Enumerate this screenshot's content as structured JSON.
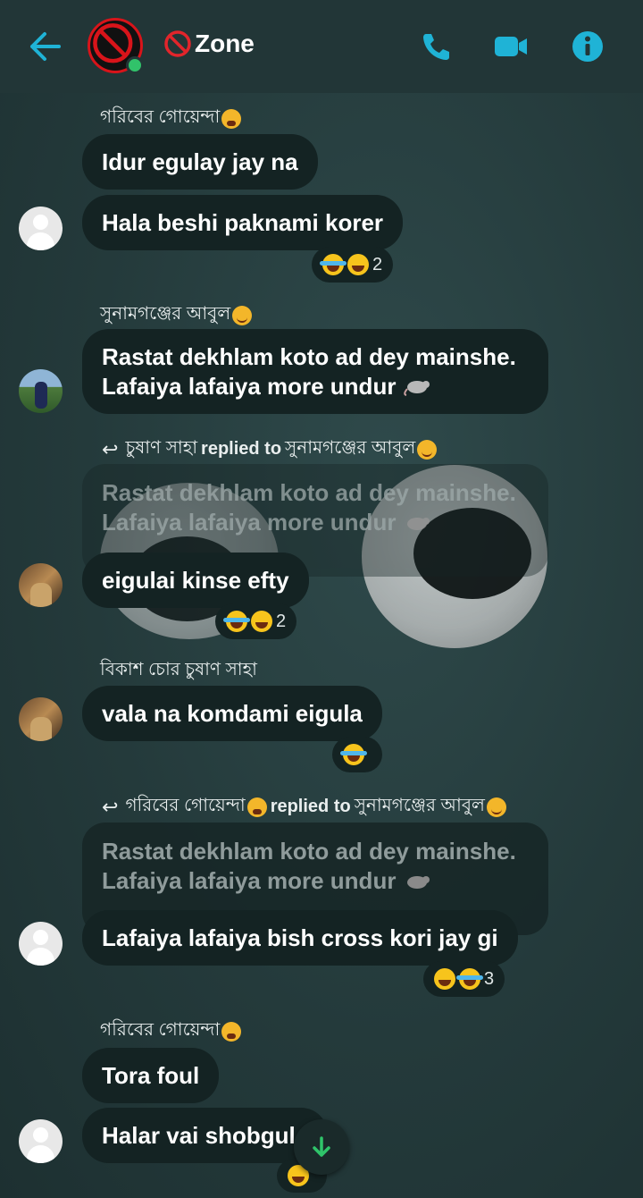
{
  "header": {
    "title": "Zone",
    "title_icon": "no-entry-icon",
    "online": true,
    "actions": [
      "call-icon",
      "video-icon",
      "info-icon"
    ]
  },
  "messages": [
    {
      "sender": "গরিবের গোয়েন্দা",
      "sender_emoji": "tired-face",
      "bubbles": [
        "Idur egulay jay na",
        "Hala beshi paknami korer"
      ],
      "reactions": {
        "emojis": [
          "joy",
          "laughing"
        ],
        "count": "2"
      }
    },
    {
      "sender": "সুনামগঞ্জের আবুল",
      "sender_emoji": "blush",
      "bubbles": [
        "Rastat dekhlam koto ad dey mainshe.",
        "Lafaiya lafaiya more undur"
      ],
      "emoji_after": "rat"
    },
    {
      "reply_from": "চুষাণ সাহা",
      "reply_word": "replied to",
      "reply_to": "সুনামগঞ্জের আবুল",
      "quote": [
        "Rastat dekhlam koto ad dey mainshe.",
        "Lafaiya lafaiya more undur"
      ],
      "bubbles": [
        "eigulai kinse efty"
      ],
      "reactions": {
        "emojis": [
          "joy",
          "laughing"
        ],
        "count": "2"
      }
    },
    {
      "sender": "বিকাশ চোর চুষাণ সাহা",
      "bubbles": [
        "vala na komdami eigula"
      ],
      "reactions": {
        "emojis": [
          "joy"
        ],
        "count": ""
      }
    },
    {
      "reply_from": "গরিবের গোয়েন্দা",
      "reply_word": "replied to",
      "reply_to": "সুনামগঞ্জের আবুল",
      "quote": [
        "Rastat dekhlam koto ad dey mainshe.",
        "Lafaiya lafaiya more undur"
      ],
      "bubbles": [
        "Lafaiya lafaiya bish cross kori jay gi"
      ],
      "reactions": {
        "emojis": [
          "laughing",
          "joy"
        ],
        "count": "3"
      }
    },
    {
      "sender": "গরিবের গোয়েন্দা",
      "sender_emoji": "tired-face",
      "bubbles": [
        "Tora foul",
        "Halar vai shobgul"
      ],
      "reactions": {
        "emojis": [
          "laughing"
        ],
        "count": ""
      }
    }
  ],
  "scroll_button_icon": "arrow-down-icon",
  "colors": {
    "accent": "#1fb3d6",
    "bubble": "#142323",
    "header": "#223637",
    "online": "#31c26a"
  }
}
